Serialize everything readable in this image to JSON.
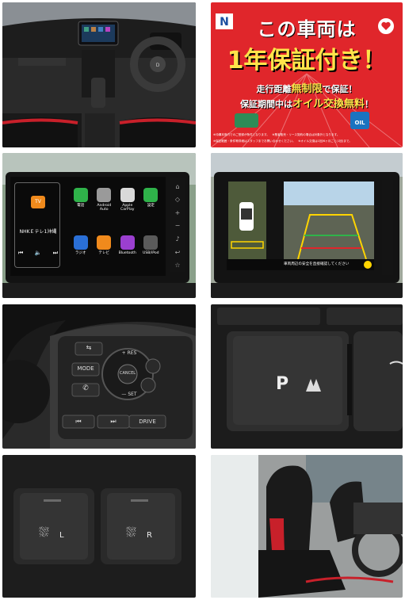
{
  "ad": {
    "headline_1": "この車両は",
    "headline_2": "1年保証付き！",
    "line_a_pre": "走行距離",
    "line_a_em": "無制限",
    "line_a_post": "で保証！",
    "line_b_pre": "保証期間中は",
    "line_b_em": "オイル交換無料",
    "line_b_post": "！",
    "footnote_1": "※沖縄本島内でのご登録が条件となります。　※業者販売・リース契約の場合は対象外となります。",
    "footnote_2": "※保証範囲・条件等詳細はスタッフまでお問い合わせください。　※オイル交換は1回/6ヶ月ごと(1回)まで。",
    "oil_tag": "OIL",
    "brand_color": "#e0262b"
  },
  "infotainment": {
    "radio_station": "NHKＥテレ1沖縄",
    "apps": [
      {
        "label": "電話",
        "icon": "phone-icon",
        "color": "#2fb34a"
      },
      {
        "label": "Android Auto",
        "icon": "android-auto-icon",
        "color": "#9a9a9a"
      },
      {
        "label": "Apple CarPlay",
        "icon": "carplay-icon",
        "color": "#d9d9d9"
      },
      {
        "label": "設定",
        "icon": "gear-icon",
        "color": "#2fb34a"
      },
      {
        "label": "ラジオ",
        "icon": "radio-icon",
        "color": "#2a6fd6"
      },
      {
        "label": "テレビ",
        "icon": "tv-icon",
        "color": "#f08a1c"
      },
      {
        "label": "Bluetooth",
        "icon": "music-icon",
        "color": "#9b3fd0"
      },
      {
        "label": "USB/iPod",
        "icon": "usb-icon",
        "color": "#5a5a5a"
      }
    ]
  },
  "camera": {
    "warning": "車両周辺の安全を直接確認してください"
  },
  "steering_controls": {
    "res": "+ RES",
    "cancel": "CANCEL",
    "set": "— SET",
    "mode": "MODE",
    "drive": "DRIVE",
    "prev": "⏮",
    "next": "⏭"
  },
  "parking_switch": {
    "label": "P"
  },
  "seat_heaters": {
    "left": "L",
    "right": "R"
  }
}
